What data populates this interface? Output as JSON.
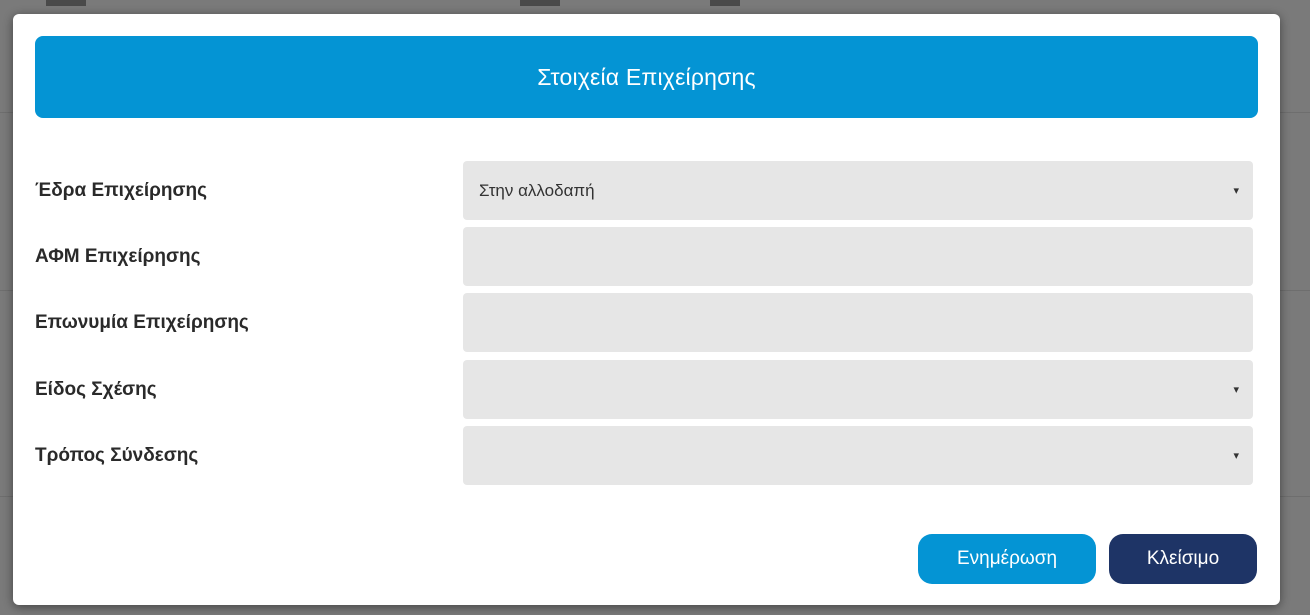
{
  "dialog": {
    "title": "Στοιχεία Επιχείρησης"
  },
  "fields": [
    {
      "label": "Έδρα Επιχείρησης",
      "value": "Στην αλλοδαπή",
      "type": "select"
    },
    {
      "label": "ΑΦΜ Επιχείρησης",
      "value": "",
      "type": "text"
    },
    {
      "label": "Επωνυμία Επιχείρησης",
      "value": "",
      "type": "text"
    },
    {
      "label": "Είδος Σχέσης",
      "value": "",
      "type": "select"
    },
    {
      "label": "Τρόπος Σύνδεσης",
      "value": "",
      "type": "select"
    }
  ],
  "caret_glyph": "▾",
  "buttons": {
    "update_label": "Ενημέρωση",
    "close_label": "Κλείσιμο"
  },
  "colors": {
    "header_bg": "#0494d4",
    "update_button_bg": "#0494d4",
    "close_button_bg": "#1e3466",
    "field_bg": "#e6e6e6",
    "overlay": "#7a7a7a"
  }
}
